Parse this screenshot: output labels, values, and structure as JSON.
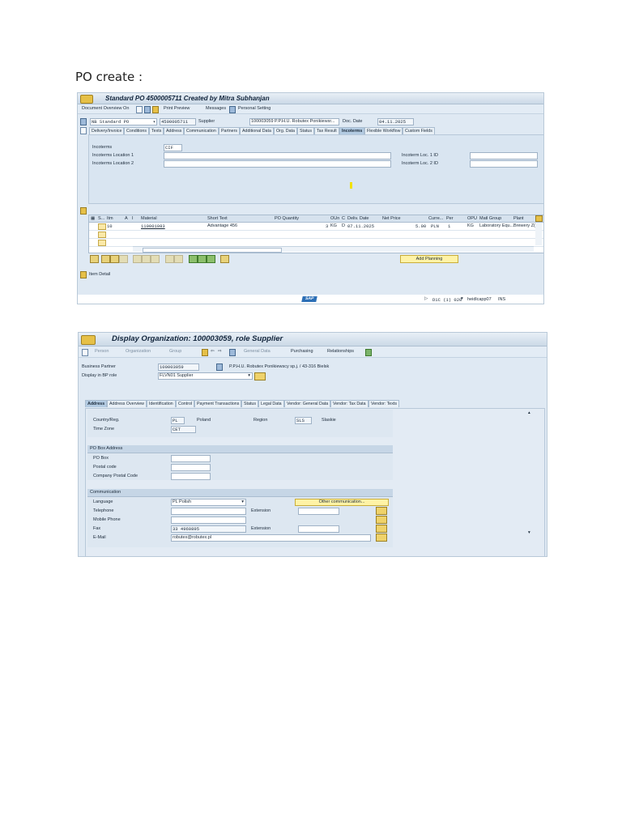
{
  "heading": "PO create :",
  "po": {
    "title": "Standard PO 4500005711 Created by Mitra Subhanjan",
    "toolbar": {
      "doc_overview": "Document Overview On",
      "print_preview": "Print Preview",
      "messages": "Messages",
      "personal_setting": "Personal Setting"
    },
    "header": {
      "po_type": "NB Standard PO",
      "po_number": "4500005711",
      "supplier_label": "Supplier",
      "supplier_value": "100003059 P.P.H.U. Robutex Ponikiewsr...",
      "doc_date_label": "Doc. Date",
      "doc_date": "04.11.2025"
    },
    "tabs": [
      "Delivery/Invoice",
      "Conditions",
      "Texts",
      "Address",
      "Communication",
      "Partners",
      "Additional Data",
      "Org. Data",
      "Status",
      "Tax Result",
      "Incoterms",
      "Flexible Workflow",
      "Custom Fields"
    ],
    "active_tab": "Incoterms",
    "incoterms": {
      "incoterms_label": "Incoterms",
      "incoterms_value": "CIF",
      "loc1_label": "Incoterms Location 1",
      "loc2_label": "Incoterms Location 2",
      "loc1_id_label": "Incoterm Loc. 1 ID",
      "loc2_id_label": "Incoterm Loc. 2 ID"
    },
    "items": {
      "columns": [
        "S...",
        "Itm",
        "A",
        "I",
        "Material",
        "Short Text",
        "PO Quantity",
        "OUn",
        "C",
        "Deliv. Date",
        "Net Price",
        "Curre...",
        "Per",
        "OPU",
        "Matl Group",
        "Plant"
      ],
      "rows": [
        {
          "itm": "10",
          "material": "110001083",
          "short_text": "Advantage 456",
          "qty": "3",
          "oun": "KG",
          "c": "D",
          "deliv_date": "07.11.2025",
          "net_price": "5.00",
          "currency": "PLN",
          "per": "1",
          "opu": "KG",
          "matl_group": "Laboratory Equ...",
          "plant": "Brewery Z("
        }
      ],
      "add_planning": "Add Planning"
    },
    "item_detail": "Item Detail",
    "status": {
      "system": "D1C (1) 020",
      "server": "heidlcapp07",
      "mode": "INS",
      "logo": "SAP"
    }
  },
  "bp": {
    "title": "Display Organization: 100003059, role Supplier",
    "toolbar": {
      "person": "Person",
      "organization": "Organization",
      "group": "Group",
      "general_data": "General Data",
      "purchasing": "Purchasing",
      "relationships": "Relationships"
    },
    "business_partner_label": "Business Partner",
    "business_partner_value": "100003059",
    "bp_name": "P.P.H.U. Robutex Ponikiewscy sp.j. / 43-316 Bielsk",
    "display_role_label": "Display in BP role",
    "display_role_value": "FLVN01 Supplier",
    "tabs": [
      "Address",
      "Address Overview",
      "Identification",
      "Control",
      "Payment Transactions",
      "Status",
      "Legal Data",
      "Vendor: General Data",
      "Vendor: Tax Data",
      "Vendor: Texts"
    ],
    "active_tab": "Address",
    "address": {
      "country_label": "Country/Reg.",
      "country_code": "PL",
      "country_name": "Poland",
      "region_label": "Region",
      "region_code": "SLS",
      "region_name": "Slaskie",
      "timezone_label": "Time Zone",
      "timezone_value": "CET"
    },
    "po_box": {
      "title": "PO Box Address",
      "po_box_label": "PO Box",
      "postal_label": "Postal code",
      "company_postal_label": "Company Postal Code"
    },
    "communication": {
      "title": "Communication",
      "language_label": "Language",
      "language_value": "PL Polish",
      "other_button": "Other communication...",
      "telephone_label": "Telephone",
      "extension_label": "Extension",
      "mobile_label": "Mobile Phone",
      "fax_label": "Fax",
      "fax_value": "33 4960895",
      "fax_extension_label": "Extension",
      "email_label": "E-Mail",
      "email_value": "robutex@robutex.pl"
    }
  }
}
